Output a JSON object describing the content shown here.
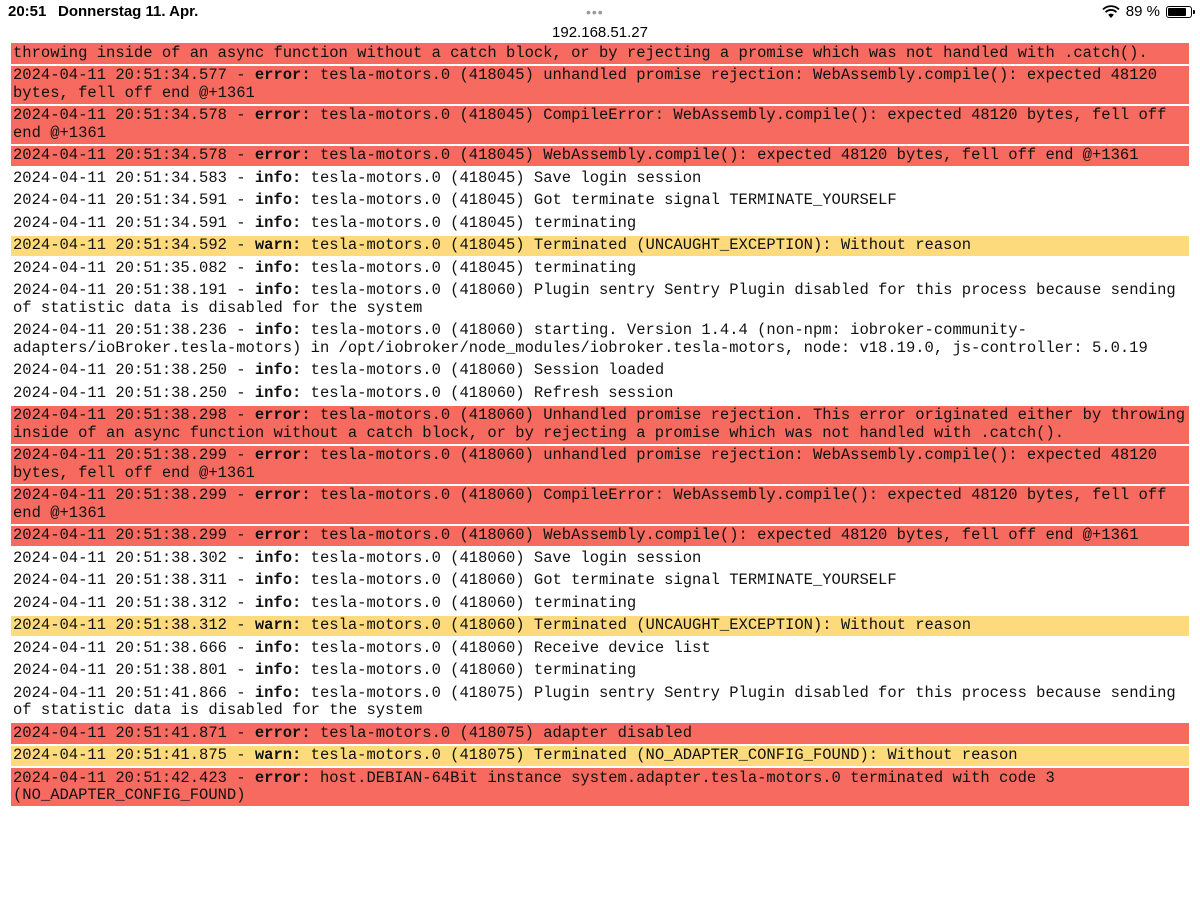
{
  "status_bar": {
    "time": "20:51",
    "date": "Donnerstag 11. Apr.",
    "battery_percent": "89 %",
    "battery_level": 0.89,
    "tab_dots": "•••"
  },
  "url": "192.168.51.27",
  "colors": {
    "error": "#f66a5f",
    "warn": "#fdda7b"
  },
  "log": [
    {
      "level": "error",
      "prefix": "",
      "severity": "",
      "message": "throwing inside of an async function without a catch block, or by rejecting a promise which was not handled with .catch()."
    },
    {
      "level": "error",
      "prefix": "2024-04-11 20:51:34.577 - ",
      "severity": "error:",
      "message": " tesla-motors.0 (418045) unhandled promise rejection: WebAssembly.compile(): expected 48120 bytes, fell off end @+1361"
    },
    {
      "level": "error",
      "prefix": "2024-04-11 20:51:34.578 - ",
      "severity": "error:",
      "message": " tesla-motors.0 (418045) CompileError: WebAssembly.compile(): expected 48120 bytes, fell off end @+1361"
    },
    {
      "level": "error",
      "prefix": "2024-04-11 20:51:34.578 - ",
      "severity": "error:",
      "message": " tesla-motors.0 (418045) WebAssembly.compile(): expected 48120 bytes, fell off end @+1361"
    },
    {
      "level": "info",
      "prefix": "2024-04-11 20:51:34.583 - ",
      "severity": "info:",
      "message": " tesla-motors.0 (418045) Save login session"
    },
    {
      "level": "info",
      "prefix": "2024-04-11 20:51:34.591 - ",
      "severity": "info:",
      "message": " tesla-motors.0 (418045) Got terminate signal TERMINATE_YOURSELF"
    },
    {
      "level": "info",
      "prefix": "2024-04-11 20:51:34.591 - ",
      "severity": "info:",
      "message": " tesla-motors.0 (418045) terminating"
    },
    {
      "level": "warn",
      "prefix": "2024-04-11 20:51:34.592 - ",
      "severity": "warn:",
      "message": " tesla-motors.0 (418045) Terminated (UNCAUGHT_EXCEPTION): Without reason"
    },
    {
      "level": "info",
      "prefix": "2024-04-11 20:51:35.082 - ",
      "severity": "info:",
      "message": " tesla-motors.0 (418045) terminating"
    },
    {
      "level": "info",
      "prefix": "2024-04-11 20:51:38.191 - ",
      "severity": "info:",
      "message": " tesla-motors.0 (418060) Plugin sentry Sentry Plugin disabled for this process because sending of statistic data is disabled for the system"
    },
    {
      "level": "info",
      "prefix": "2024-04-11 20:51:38.236 - ",
      "severity": "info:",
      "message": " tesla-motors.0 (418060) starting. Version 1.4.4 (non-npm: iobroker-community-adapters/ioBroker.tesla-motors) in /opt/iobroker/node_modules/iobroker.tesla-motors, node: v18.19.0, js-controller: 5.0.19"
    },
    {
      "level": "info",
      "prefix": "2024-04-11 20:51:38.250 - ",
      "severity": "info:",
      "message": " tesla-motors.0 (418060) Session loaded"
    },
    {
      "level": "info",
      "prefix": "2024-04-11 20:51:38.250 - ",
      "severity": "info:",
      "message": " tesla-motors.0 (418060) Refresh session"
    },
    {
      "level": "error",
      "prefix": "2024-04-11 20:51:38.298 - ",
      "severity": "error:",
      "message": " tesla-motors.0 (418060) Unhandled promise rejection. This error originated either by throwing inside of an async function without a catch block, or by rejecting a promise which was not handled with .catch()."
    },
    {
      "level": "error",
      "prefix": "2024-04-11 20:51:38.299 - ",
      "severity": "error:",
      "message": " tesla-motors.0 (418060) unhandled promise rejection: WebAssembly.compile(): expected 48120 bytes, fell off end @+1361"
    },
    {
      "level": "error",
      "prefix": "2024-04-11 20:51:38.299 - ",
      "severity": "error:",
      "message": " tesla-motors.0 (418060) CompileError: WebAssembly.compile(): expected 48120 bytes, fell off end @+1361"
    },
    {
      "level": "error",
      "prefix": "2024-04-11 20:51:38.299 - ",
      "severity": "error:",
      "message": " tesla-motors.0 (418060) WebAssembly.compile(): expected 48120 bytes, fell off end @+1361"
    },
    {
      "level": "info",
      "prefix": "2024-04-11 20:51:38.302 - ",
      "severity": "info:",
      "message": " tesla-motors.0 (418060) Save login session"
    },
    {
      "level": "info",
      "prefix": "2024-04-11 20:51:38.311 - ",
      "severity": "info:",
      "message": " tesla-motors.0 (418060) Got terminate signal TERMINATE_YOURSELF"
    },
    {
      "level": "info",
      "prefix": "2024-04-11 20:51:38.312 - ",
      "severity": "info:",
      "message": " tesla-motors.0 (418060) terminating"
    },
    {
      "level": "warn",
      "prefix": "2024-04-11 20:51:38.312 - ",
      "severity": "warn:",
      "message": " tesla-motors.0 (418060) Terminated (UNCAUGHT_EXCEPTION): Without reason"
    },
    {
      "level": "info",
      "prefix": "2024-04-11 20:51:38.666 - ",
      "severity": "info:",
      "message": " tesla-motors.0 (418060) Receive device list"
    },
    {
      "level": "info",
      "prefix": "2024-04-11 20:51:38.801 - ",
      "severity": "info:",
      "message": " tesla-motors.0 (418060) terminating"
    },
    {
      "level": "info",
      "prefix": "2024-04-11 20:51:41.866 - ",
      "severity": "info:",
      "message": " tesla-motors.0 (418075) Plugin sentry Sentry Plugin disabled for this process because sending of statistic data is disabled for the system"
    },
    {
      "level": "error",
      "prefix": "2024-04-11 20:51:41.871 - ",
      "severity": "error:",
      "message": " tesla-motors.0 (418075) adapter disabled"
    },
    {
      "level": "warn",
      "prefix": "2024-04-11 20:51:41.875 - ",
      "severity": "warn:",
      "message": " tesla-motors.0 (418075) Terminated (NO_ADAPTER_CONFIG_FOUND): Without reason"
    },
    {
      "level": "error",
      "prefix": "2024-04-11 20:51:42.423 - ",
      "severity": "error:",
      "message": " host.DEBIAN-64Bit instance system.adapter.tesla-motors.0 terminated with code 3 (NO_ADAPTER_CONFIG_FOUND)"
    }
  ]
}
